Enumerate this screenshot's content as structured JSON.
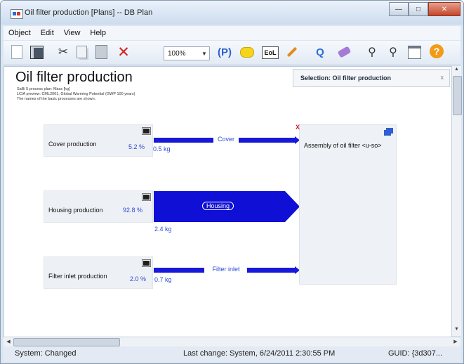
{
  "window": {
    "title": "Oil filter production [Plans] -- DB Plan",
    "controls": [
      "minimize-button",
      "maximize-button",
      "close-button"
    ]
  },
  "menu": [
    "Object",
    "Edit",
    "View",
    "Help"
  ],
  "toolbar": {
    "icons": [
      "new-icon",
      "save-icon",
      "cut-icon",
      "copy-icon",
      "paste-icon",
      "delete-icon",
      "parameter-icon",
      "comment-icon",
      "eol-icon",
      "pencil-icon",
      "quantity-icon",
      "eraser-icon",
      "zoom-out-icon",
      "zoom-in-icon",
      "window-icon",
      "help-icon"
    ],
    "zoom_value": "100%",
    "p_label": "(P)",
    "eol_label": "EoL",
    "q_label": "Q",
    "help_label": "?"
  },
  "plan": {
    "title": "Oil filter production",
    "subtitle_lines": [
      "SaBi 5 process plan: Mass [kg]",
      "LCIA preview: CML2001, Global Warming Potential (GWP 100 years)",
      "The names of the basic processes are shown."
    ]
  },
  "selection": {
    "label": "Selection: Oil filter production",
    "close": "x"
  },
  "processes": [
    {
      "name": "Cover production",
      "percent": "5.2 %",
      "amount": "0.5 kg",
      "flow": "Cover"
    },
    {
      "name": "Housing production",
      "percent": "92.8 %",
      "amount": "2.4 kg",
      "flow": "Housing"
    },
    {
      "name": "Filter inlet production",
      "percent": "2.0 %",
      "amount": "0.7 kg",
      "flow": "Filter inlet"
    }
  ],
  "assembly": {
    "name": "Assembly of oil filter",
    "suffix": "<u-so>",
    "marker": "X"
  },
  "status": {
    "left": "System: Changed",
    "middle": "Last change: System, 6/24/2011 2:30:55 PM",
    "right": "GUID: {3d307..."
  },
  "colors": {
    "flow_blue": "#1010d8",
    "percent_blue": "#2f4bd6",
    "process_box": "#edf0f4"
  }
}
